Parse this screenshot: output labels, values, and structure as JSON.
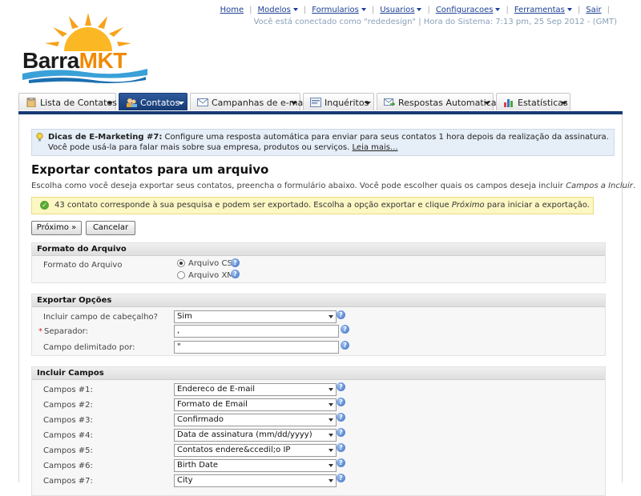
{
  "top_nav": {
    "items": [
      "Home",
      "Modelos",
      "Formularios",
      "Usuarios",
      "Configuracoes",
      "Ferramentas",
      "Sair"
    ],
    "login_text": "Você está conectado como \"rededesign\" | Hora do Sistema: 7:13 pm, 25 Sep 2012 - (GMT)"
  },
  "logo": {
    "part1": "Barra",
    "part2": "MKT"
  },
  "tabs": [
    {
      "label": "Lista de Contatos",
      "icon": "clipboard-icon"
    },
    {
      "label": "Contatos",
      "icon": "users-icon",
      "active": true
    },
    {
      "label": "Campanhas de e-mail",
      "icon": "envelope-icon"
    },
    {
      "label": "Inquéritos",
      "icon": "form-icon"
    },
    {
      "label": "Respostas Automaticas",
      "icon": "autoresponder-icon"
    },
    {
      "label": "Estatísticas",
      "icon": "bar-chart-icon"
    }
  ],
  "tip": {
    "title": "Dicas de E-Marketing #7:",
    "text": " Configure uma resposta automática para enviar para seus contatos 1 hora depois da realização da assinatura. Você pode usá-la para falar mais sobre sua empresa, produtos ou serviços.",
    "link": "Leia mais..."
  },
  "page_title": "Exportar contatos para um arquivo",
  "description": {
    "text": "Escolha como você deseja exportar seus contatos, preencha o formulário abaixo. Você pode escolher quais os campos deseja incluir ",
    "emphasis": "Campos a Incluir",
    "end": "."
  },
  "notice": {
    "text1": "43 contato corresponde à sua pesquisa e podem ser exportado. Escolha a opção exportar e clique ",
    "emphasis": "Próximo",
    "text2": " para iniciar a exportação."
  },
  "buttons": {
    "next": "Próximo »",
    "cancel": "Cancelar"
  },
  "format_section": {
    "header": "Formato do Arquivo",
    "label": "Formato do Arquivo",
    "options": [
      "Arquivo CSV",
      "Arquivo XML"
    ],
    "selected": 0
  },
  "export_section": {
    "header": "Exportar Opções",
    "include_header": {
      "label": "Incluir campo de cabeçalho?",
      "value": "Sim"
    },
    "separator": {
      "label": "Separador:",
      "value": ","
    },
    "enclosed": {
      "label": "Campo delimitado por:",
      "value": "\""
    }
  },
  "fields_section": {
    "header": "Incluir Campos",
    "fields": [
      {
        "label": "Campos #1:",
        "value": "Endereco de E-mail"
      },
      {
        "label": "Campos #2:",
        "value": "Formato de Email"
      },
      {
        "label": "Campos #3:",
        "value": "Confirmado"
      },
      {
        "label": "Campos #4:",
        "value": "Data de assinatura (mm/dd/yyyy)"
      },
      {
        "label": "Campos #5:",
        "value": "Contatos endere&ccedil;o IP"
      },
      {
        "label": "Campos #6:",
        "value": "Birth Date"
      },
      {
        "label": "Campos #7:",
        "value": "City"
      }
    ]
  }
}
